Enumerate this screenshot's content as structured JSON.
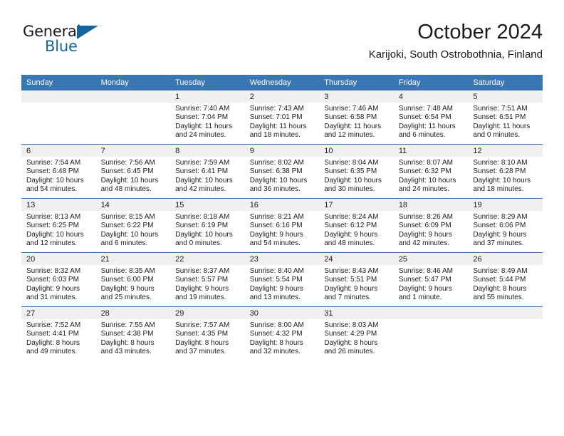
{
  "brand": {
    "name_part1": "General",
    "name_part2": "Blue",
    "accent_color": "#15659f"
  },
  "header": {
    "month_title": "October 2024",
    "location": "Karijoki, South Ostrobothnia, Finland"
  },
  "calendar": {
    "header_color": "#3a76b4",
    "weekdays": [
      "Sunday",
      "Monday",
      "Tuesday",
      "Wednesday",
      "Thursday",
      "Friday",
      "Saturday"
    ],
    "weeks": [
      [
        {
          "day": "",
          "sunrise": "",
          "sunset": "",
          "daylight": "",
          "daylight2": ""
        },
        {
          "day": "",
          "sunrise": "",
          "sunset": "",
          "daylight": "",
          "daylight2": ""
        },
        {
          "day": "1",
          "sunrise": "Sunrise: 7:40 AM",
          "sunset": "Sunset: 7:04 PM",
          "daylight": "Daylight: 11 hours",
          "daylight2": "and 24 minutes."
        },
        {
          "day": "2",
          "sunrise": "Sunrise: 7:43 AM",
          "sunset": "Sunset: 7:01 PM",
          "daylight": "Daylight: 11 hours",
          "daylight2": "and 18 minutes."
        },
        {
          "day": "3",
          "sunrise": "Sunrise: 7:46 AM",
          "sunset": "Sunset: 6:58 PM",
          "daylight": "Daylight: 11 hours",
          "daylight2": "and 12 minutes."
        },
        {
          "day": "4",
          "sunrise": "Sunrise: 7:48 AM",
          "sunset": "Sunset: 6:54 PM",
          "daylight": "Daylight: 11 hours",
          "daylight2": "and 6 minutes."
        },
        {
          "day": "5",
          "sunrise": "Sunrise: 7:51 AM",
          "sunset": "Sunset: 6:51 PM",
          "daylight": "Daylight: 11 hours",
          "daylight2": "and 0 minutes."
        }
      ],
      [
        {
          "day": "6",
          "sunrise": "Sunrise: 7:54 AM",
          "sunset": "Sunset: 6:48 PM",
          "daylight": "Daylight: 10 hours",
          "daylight2": "and 54 minutes."
        },
        {
          "day": "7",
          "sunrise": "Sunrise: 7:56 AM",
          "sunset": "Sunset: 6:45 PM",
          "daylight": "Daylight: 10 hours",
          "daylight2": "and 48 minutes."
        },
        {
          "day": "8",
          "sunrise": "Sunrise: 7:59 AM",
          "sunset": "Sunset: 6:41 PM",
          "daylight": "Daylight: 10 hours",
          "daylight2": "and 42 minutes."
        },
        {
          "day": "9",
          "sunrise": "Sunrise: 8:02 AM",
          "sunset": "Sunset: 6:38 PM",
          "daylight": "Daylight: 10 hours",
          "daylight2": "and 36 minutes."
        },
        {
          "day": "10",
          "sunrise": "Sunrise: 8:04 AM",
          "sunset": "Sunset: 6:35 PM",
          "daylight": "Daylight: 10 hours",
          "daylight2": "and 30 minutes."
        },
        {
          "day": "11",
          "sunrise": "Sunrise: 8:07 AM",
          "sunset": "Sunset: 6:32 PM",
          "daylight": "Daylight: 10 hours",
          "daylight2": "and 24 minutes."
        },
        {
          "day": "12",
          "sunrise": "Sunrise: 8:10 AM",
          "sunset": "Sunset: 6:28 PM",
          "daylight": "Daylight: 10 hours",
          "daylight2": "and 18 minutes."
        }
      ],
      [
        {
          "day": "13",
          "sunrise": "Sunrise: 8:13 AM",
          "sunset": "Sunset: 6:25 PM",
          "daylight": "Daylight: 10 hours",
          "daylight2": "and 12 minutes."
        },
        {
          "day": "14",
          "sunrise": "Sunrise: 8:15 AM",
          "sunset": "Sunset: 6:22 PM",
          "daylight": "Daylight: 10 hours",
          "daylight2": "and 6 minutes."
        },
        {
          "day": "15",
          "sunrise": "Sunrise: 8:18 AM",
          "sunset": "Sunset: 6:19 PM",
          "daylight": "Daylight: 10 hours",
          "daylight2": "and 0 minutes."
        },
        {
          "day": "16",
          "sunrise": "Sunrise: 8:21 AM",
          "sunset": "Sunset: 6:16 PM",
          "daylight": "Daylight: 9 hours",
          "daylight2": "and 54 minutes."
        },
        {
          "day": "17",
          "sunrise": "Sunrise: 8:24 AM",
          "sunset": "Sunset: 6:12 PM",
          "daylight": "Daylight: 9 hours",
          "daylight2": "and 48 minutes."
        },
        {
          "day": "18",
          "sunrise": "Sunrise: 8:26 AM",
          "sunset": "Sunset: 6:09 PM",
          "daylight": "Daylight: 9 hours",
          "daylight2": "and 42 minutes."
        },
        {
          "day": "19",
          "sunrise": "Sunrise: 8:29 AM",
          "sunset": "Sunset: 6:06 PM",
          "daylight": "Daylight: 9 hours",
          "daylight2": "and 37 minutes."
        }
      ],
      [
        {
          "day": "20",
          "sunrise": "Sunrise: 8:32 AM",
          "sunset": "Sunset: 6:03 PM",
          "daylight": "Daylight: 9 hours",
          "daylight2": "and 31 minutes."
        },
        {
          "day": "21",
          "sunrise": "Sunrise: 8:35 AM",
          "sunset": "Sunset: 6:00 PM",
          "daylight": "Daylight: 9 hours",
          "daylight2": "and 25 minutes."
        },
        {
          "day": "22",
          "sunrise": "Sunrise: 8:37 AM",
          "sunset": "Sunset: 5:57 PM",
          "daylight": "Daylight: 9 hours",
          "daylight2": "and 19 minutes."
        },
        {
          "day": "23",
          "sunrise": "Sunrise: 8:40 AM",
          "sunset": "Sunset: 5:54 PM",
          "daylight": "Daylight: 9 hours",
          "daylight2": "and 13 minutes."
        },
        {
          "day": "24",
          "sunrise": "Sunrise: 8:43 AM",
          "sunset": "Sunset: 5:51 PM",
          "daylight": "Daylight: 9 hours",
          "daylight2": "and 7 minutes."
        },
        {
          "day": "25",
          "sunrise": "Sunrise: 8:46 AM",
          "sunset": "Sunset: 5:47 PM",
          "daylight": "Daylight: 9 hours",
          "daylight2": "and 1 minute."
        },
        {
          "day": "26",
          "sunrise": "Sunrise: 8:49 AM",
          "sunset": "Sunset: 5:44 PM",
          "daylight": "Daylight: 8 hours",
          "daylight2": "and 55 minutes."
        }
      ],
      [
        {
          "day": "27",
          "sunrise": "Sunrise: 7:52 AM",
          "sunset": "Sunset: 4:41 PM",
          "daylight": "Daylight: 8 hours",
          "daylight2": "and 49 minutes."
        },
        {
          "day": "28",
          "sunrise": "Sunrise: 7:55 AM",
          "sunset": "Sunset: 4:38 PM",
          "daylight": "Daylight: 8 hours",
          "daylight2": "and 43 minutes."
        },
        {
          "day": "29",
          "sunrise": "Sunrise: 7:57 AM",
          "sunset": "Sunset: 4:35 PM",
          "daylight": "Daylight: 8 hours",
          "daylight2": "and 37 minutes."
        },
        {
          "day": "30",
          "sunrise": "Sunrise: 8:00 AM",
          "sunset": "Sunset: 4:32 PM",
          "daylight": "Daylight: 8 hours",
          "daylight2": "and 32 minutes."
        },
        {
          "day": "31",
          "sunrise": "Sunrise: 8:03 AM",
          "sunset": "Sunset: 4:29 PM",
          "daylight": "Daylight: 8 hours",
          "daylight2": "and 26 minutes."
        },
        {
          "day": "",
          "sunrise": "",
          "sunset": "",
          "daylight": "",
          "daylight2": ""
        },
        {
          "day": "",
          "sunrise": "",
          "sunset": "",
          "daylight": "",
          "daylight2": ""
        }
      ]
    ]
  }
}
